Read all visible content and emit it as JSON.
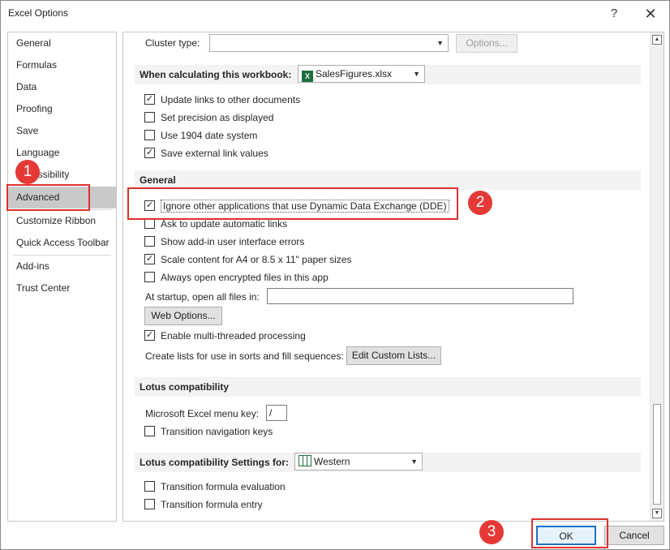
{
  "window": {
    "title": "Excel Options",
    "help_glyph": "?",
    "close_glyph": "✕"
  },
  "nav": {
    "items": [
      {
        "label": "General"
      },
      {
        "label": "Formulas"
      },
      {
        "label": "Data"
      },
      {
        "label": "Proofing"
      },
      {
        "label": "Save"
      },
      {
        "label": "Language"
      },
      {
        "label": "Accessibility"
      },
      {
        "label": "Advanced",
        "selected": true
      },
      {
        "label": "Customize Ribbon"
      },
      {
        "label": "Quick Access Toolbar"
      },
      {
        "label": "Add-ins"
      },
      {
        "label": "Trust Center"
      }
    ]
  },
  "content": {
    "cluster_type_label": "Cluster type:",
    "cluster_type_value": "",
    "options_button": "Options...",
    "workbook_section": {
      "heading": "When calculating this workbook:",
      "workbook_value": "SalesFigures.xlsx",
      "checks": [
        {
          "label": "Update links to other documents",
          "checked": true
        },
        {
          "label": "Set precision as displayed",
          "checked": false
        },
        {
          "label": "Use 1904 date system",
          "checked": false
        },
        {
          "label": "Save external link values",
          "checked": true
        }
      ]
    },
    "general_section": {
      "heading": "General",
      "checks": [
        {
          "label": "Ignore other applications that use Dynamic Data Exchange (DDE)",
          "checked": true
        },
        {
          "label": "Ask to update automatic links",
          "checked": false
        },
        {
          "label": "Show add-in user interface errors",
          "checked": false
        },
        {
          "label": "Scale content for A4 or 8.5 x 11\" paper sizes",
          "checked": true
        },
        {
          "label": "Always open encrypted files in this app",
          "checked": false
        }
      ],
      "startup_label": "At startup, open all files in:",
      "startup_value": "",
      "web_options_button": "Web Options...",
      "multithread_label": "Enable multi-threaded processing",
      "multithread_checked": true,
      "lists_label": "Create lists for use in sorts and fill sequences:",
      "edit_lists_button": "Edit Custom Lists..."
    },
    "lotus_section": {
      "heading": "Lotus compatibility",
      "menu_key_label": "Microsoft Excel menu key:",
      "menu_key_value": "/",
      "nav_keys_label": "Transition navigation keys",
      "nav_keys_checked": false
    },
    "lotus_settings_section": {
      "heading": "Lotus compatibility Settings for:",
      "sheet_value": "Western",
      "checks": [
        {
          "label": "Transition formula evaluation",
          "checked": false
        },
        {
          "label": "Transition formula entry",
          "checked": false
        }
      ]
    }
  },
  "footer": {
    "ok": "OK",
    "cancel": "Cancel"
  },
  "callouts": {
    "one": "1",
    "two": "2",
    "three": "3"
  },
  "colors": {
    "callout": "#e53935",
    "selected_nav": "#c9c9c9",
    "excel_green": "#1d6f42"
  }
}
